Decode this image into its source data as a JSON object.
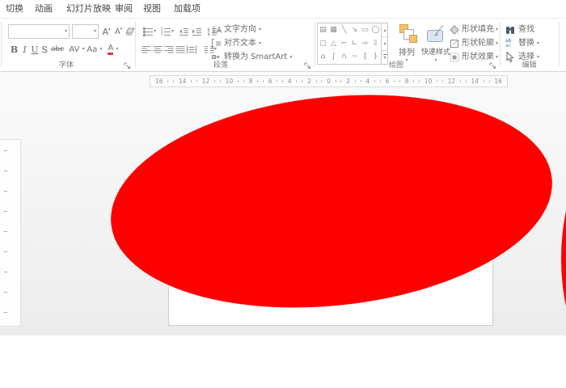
{
  "tabs": [
    "切换",
    "动画",
    "幻灯片放映",
    "审阅",
    "视图",
    "加载项"
  ],
  "font_group": {
    "label": "字体",
    "grow_font": "A",
    "shrink_font": "A",
    "bold": "B",
    "italic": "I",
    "underline": "U",
    "shadow": "S",
    "strikethrough": "abc",
    "char_spacing": "AV",
    "change_case": "Aa",
    "font_color": "A"
  },
  "paragraph_group": {
    "label": "段落",
    "text_direction": "文字方向",
    "align_text": "对齐文本",
    "convert_smartart": "转换为 SmartArt"
  },
  "drawing_group": {
    "label": "绘图",
    "arrange": "排列",
    "quick_styles": "快速样式",
    "shape_fill": "形状填充",
    "shape_outline": "形状轮廓",
    "shape_effects": "形状效果",
    "gallery": [
      "▤",
      "▦",
      "╲",
      "↘",
      "▭",
      "◯",
      "▢",
      "△",
      "⌐",
      "∟",
      "⇨",
      "⇩",
      "⌂",
      "∫",
      "∩",
      "~",
      "{",
      "}"
    ]
  },
  "editing_group": {
    "label": "编辑",
    "find": "查找",
    "replace": "替换",
    "select": "选择",
    "replace_glyph_top": "ab",
    "replace_glyph_bottom": "ac"
  },
  "ruler": {
    "numbers": [
      "16",
      "14",
      "12",
      "10",
      "8",
      "6",
      "4",
      "2",
      "0",
      "2",
      "4",
      "6",
      "8",
      "10",
      "12",
      "14",
      "16"
    ]
  },
  "canvas": {
    "shape_color": "#FF0000"
  }
}
